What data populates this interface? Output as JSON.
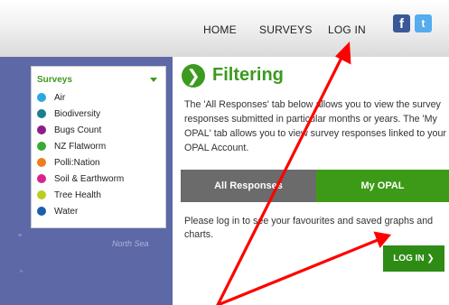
{
  "nav": {
    "home": "HOME",
    "surveys": "SURVEYS",
    "login": "LOG IN",
    "facebook_glyph": "f",
    "twitter_glyph": "t"
  },
  "surveys": {
    "title": "Surveys",
    "items": [
      {
        "label": "Air",
        "color": "#2aa9df"
      },
      {
        "label": "Biodiversity",
        "color": "#1a7f8e"
      },
      {
        "label": "Bugs Count",
        "color": "#8b1f8a"
      },
      {
        "label": "NZ Flatworm",
        "color": "#3aaa35"
      },
      {
        "label": "Polli:Nation",
        "color": "#ef7d1a"
      },
      {
        "label": "Soil & Earthworm",
        "color": "#d6258a"
      },
      {
        "label": "Tree Health",
        "color": "#b7cf1d"
      },
      {
        "label": "Water",
        "color": "#1b5fae"
      }
    ]
  },
  "map": {
    "label": "North Sea"
  },
  "filtering": {
    "icon": "❯",
    "title": "Filtering",
    "description": "The 'All Responses' tab below allows you to view the survey responses submitted in particular months or years. The 'My OPAL' tab allows you to view survey responses linked to your OPAL Account."
  },
  "tabs": {
    "all_responses": "All Responses",
    "my_opal": "My OPAL"
  },
  "content": {
    "login_message": "Please log in to see your favourites and saved graphs and charts.",
    "login_button": "LOG IN ❯"
  },
  "colors": {
    "accent_green": "#3c9a1f",
    "tab_inactive": "#6b6b6b",
    "map_blue": "#5d68a7",
    "annotation_red": "#ff0000"
  }
}
